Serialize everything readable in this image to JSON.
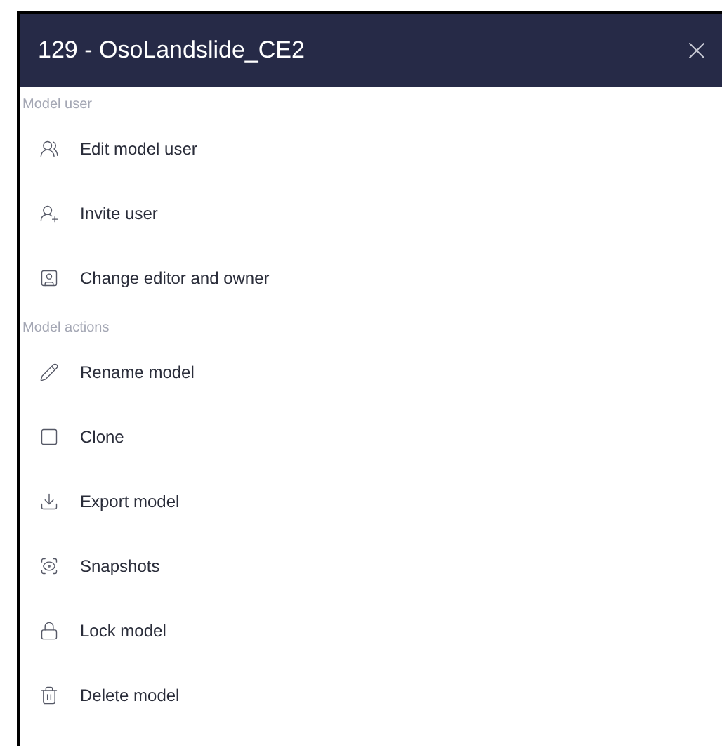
{
  "panel": {
    "title": "129 - OsoLandslide_CE2"
  },
  "sections": [
    {
      "heading": "Model user",
      "items": [
        {
          "label": "Edit model user"
        },
        {
          "label": "Invite user"
        },
        {
          "label": "Change editor and owner"
        }
      ]
    },
    {
      "heading": "Model actions",
      "items": [
        {
          "label": "Rename model"
        },
        {
          "label": "Clone"
        },
        {
          "label": "Export model"
        },
        {
          "label": "Snapshots"
        },
        {
          "label": "Lock model"
        },
        {
          "label": "Delete model"
        }
      ]
    }
  ]
}
